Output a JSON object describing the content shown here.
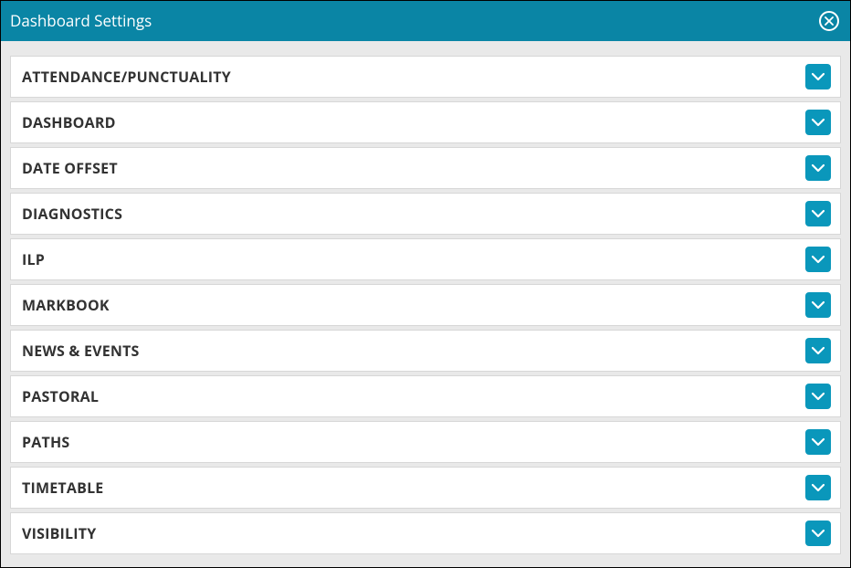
{
  "header": {
    "title": "Dashboard Settings"
  },
  "panels": [
    {
      "label": "ATTENDANCE/PUNCTUALITY"
    },
    {
      "label": "DASHBOARD"
    },
    {
      "label": "DATE OFFSET"
    },
    {
      "label": "DIAGNOSTICS"
    },
    {
      "label": "ILP"
    },
    {
      "label": "MARKBOOK"
    },
    {
      "label": "NEWS & EVENTS"
    },
    {
      "label": "PASTORAL"
    },
    {
      "label": "PATHS"
    },
    {
      "label": "TIMETABLE"
    },
    {
      "label": "VISIBILITY"
    }
  ]
}
